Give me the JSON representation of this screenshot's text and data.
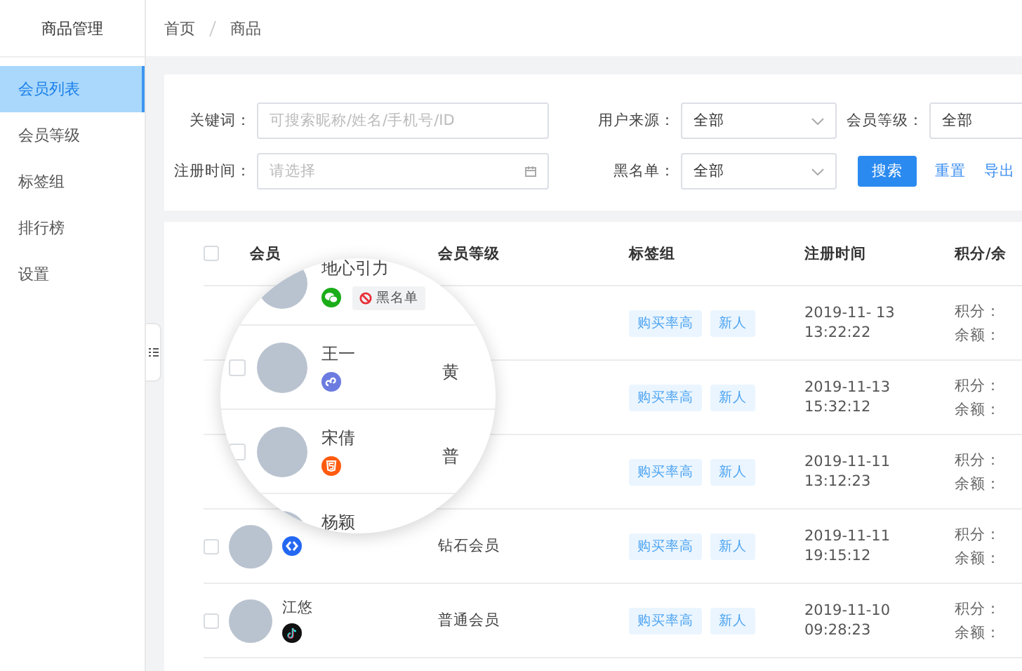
{
  "sidebar": {
    "title": "商品管理",
    "items": [
      {
        "label": "会员列表",
        "selected": true
      },
      {
        "label": "会员等级",
        "selected": false
      },
      {
        "label": "标签组",
        "selected": false
      },
      {
        "label": "排行榜",
        "selected": false
      },
      {
        "label": "设置",
        "selected": false
      }
    ]
  },
  "breadcrumb": [
    "首页",
    "商品"
  ],
  "filters": [
    {
      "label": "关键词：",
      "kind": "text",
      "placeholder": "可搜索昵称/姓名/手机号/ID"
    },
    {
      "label": "用户来源：",
      "kind": "select",
      "value": "全部"
    },
    {
      "label": "会员等级：",
      "kind": "select",
      "value": "全部"
    },
    {
      "label": "注册时间：",
      "kind": "date",
      "placeholder": "请选择"
    },
    {
      "label": "黑名单：",
      "kind": "select",
      "value": "全部"
    }
  ],
  "actions": [
    {
      "label": "搜索",
      "kind": "primary"
    },
    {
      "label": "重置",
      "kind": "link"
    },
    {
      "label": "导出",
      "kind": "link"
    }
  ],
  "table": {
    "select_all_checked": false,
    "columns": [
      "会员",
      "会员等级",
      "标签组",
      "注册时间",
      "积分/余"
    ],
    "rows": [
      {
        "tags": [
          "购买率高",
          "新人"
        ],
        "date": "2019-11- 13",
        "time": "13:22:22",
        "points_label": "积分：",
        "balance_label": "余额："
      },
      {
        "tags": [
          "购买率高",
          "新人"
        ],
        "date": "2019-11-13",
        "time": "15:32:12",
        "points_label": "积分：",
        "balance_label": "余额："
      },
      {
        "tags": [
          "购买率高",
          "新人"
        ],
        "date": "2019-11-11",
        "time": "13:12:23",
        "points_label": "积分：",
        "balance_label": "余额："
      },
      {
        "checked": false,
        "member": {
          "kind": "app"
        },
        "level": "钻石会员",
        "tags": [
          "购买率高",
          "新人"
        ],
        "date": "2019-11-11",
        "time": "19:15:12",
        "points_label": "积分：",
        "balance_label": "余额："
      },
      {
        "checked": false,
        "member": {
          "name": "江悠",
          "kind": "douyin"
        },
        "level": "普通会员",
        "tags": [
          "购买率高",
          "新人"
        ],
        "date": "2019-11-10",
        "time": "09:28:23",
        "points_label": "积分：",
        "balance_label": "余额："
      },
      {
        "member": {}
      }
    ]
  },
  "magnifier": {
    "entries": [
      {
        "name": "地心引力",
        "kind": "wechat",
        "badge": "黑名单"
      },
      {
        "checked": false,
        "name": "王一",
        "kind": "miniapp",
        "level": "黄"
      },
      {
        "checked": false,
        "name": "宋倩",
        "kind": "h5",
        "level": "普"
      },
      {
        "name": "杨颖",
        "kind": "app"
      }
    ]
  }
}
